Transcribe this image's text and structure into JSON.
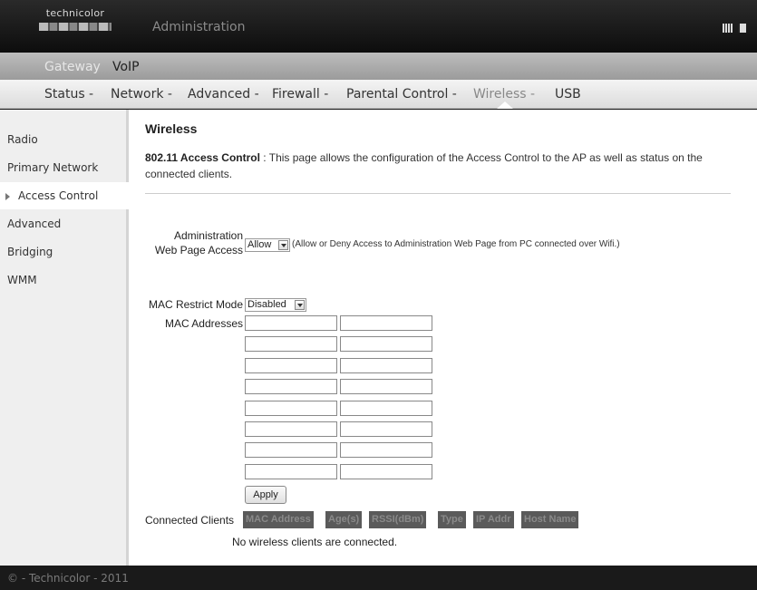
{
  "header": {
    "logo_text": "technicolor",
    "title": "Administration"
  },
  "nav_top": {
    "items": [
      "Gateway",
      "VoIP"
    ]
  },
  "nav_main": {
    "items": [
      "Status -",
      "Network -",
      "Advanced -",
      "Firewall -",
      "Parental Control -",
      "Wireless -",
      "USB"
    ],
    "active": "Wireless -"
  },
  "sidebar": {
    "items": [
      "Radio",
      "Primary Network",
      "Access Control",
      "Advanced",
      "Bridging",
      "WMM"
    ],
    "active": "Access Control"
  },
  "content": {
    "title": "Wireless",
    "desc_bold": "802.11 Access Control",
    "desc_text": " :  This page allows the configuration of the Access Control to the AP as well as status on the connected clients.",
    "admin_label_1": "Administration",
    "admin_label_2": "Web Page Access",
    "admin_select": "Allow",
    "admin_note": "(Allow or Deny Access to Administration Web Page from PC connected over Wifi.)",
    "mac_mode_label": "MAC Restrict Mode",
    "mac_mode_select": "Disabled",
    "mac_addr_label": "MAC Addresses",
    "mac_addresses": [
      "",
      "",
      "",
      "",
      "",
      "",
      "",
      "",
      "",
      "",
      "",
      "",
      "",
      "",
      "",
      ""
    ],
    "apply_label": "Apply",
    "clients_label": "Connected Clients",
    "clients_headers": [
      "MAC Address",
      "Age(s)",
      "RSSI(dBm)",
      "Type",
      "IP Addr",
      "Host Name"
    ],
    "no_clients": "No wireless clients are connected."
  },
  "footer": {
    "text": "© - Technicolor - 2011"
  }
}
